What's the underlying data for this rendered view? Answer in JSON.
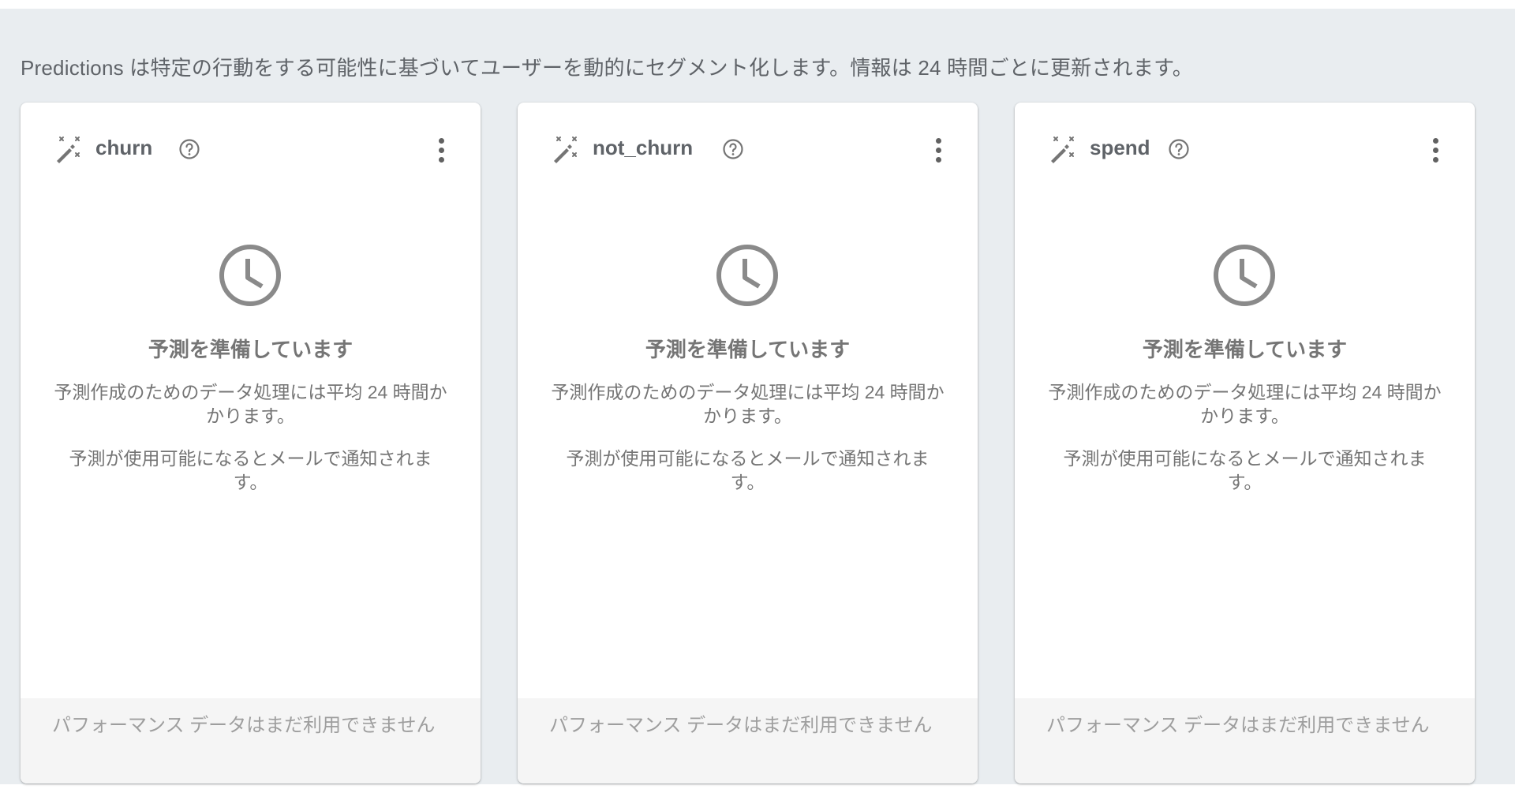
{
  "description": "Predictions は特定の行動をする可能性に基づいてユーザーを動的にセグメント化します。情報は 24 時間ごとに更新されます。",
  "cards": [
    {
      "title": "churn",
      "help_icon": "help-circle-icon",
      "menu_icon": "more-vert-icon",
      "status_icon": "clock-icon",
      "status_title": "予測を準備しています",
      "status_text_1": "予測作成のためのデータ処理には平均 24 時間かかります。",
      "status_text_2": "予測が使用可能になるとメールで通知されます。",
      "footer_text": "パフォーマンス データはまだ利用できません"
    },
    {
      "title": "not_churn",
      "help_icon": "help-circle-icon",
      "menu_icon": "more-vert-icon",
      "status_icon": "clock-icon",
      "status_title": "予測を準備しています",
      "status_text_1": "予測作成のためのデータ処理には平均 24 時間かかります。",
      "status_text_2": "予測が使用可能になるとメールで通知されます。",
      "footer_text": "パフォーマンス データはまだ利用できません"
    },
    {
      "title": "spend",
      "help_icon": "help-circle-icon",
      "menu_icon": "more-vert-icon",
      "status_icon": "clock-icon",
      "status_title": "予測を準備しています",
      "status_text_1": "予測作成のためのデータ処理には平均 24 時間かかります。",
      "status_text_2": "予測が使用可能になるとメールで通知されます。",
      "footer_text": "パフォーマンス データはまだ利用できません"
    }
  ],
  "colors": {
    "background": "#e9edf0",
    "card": "#ffffff",
    "footer": "#f5f5f5",
    "icon": "#757575"
  }
}
